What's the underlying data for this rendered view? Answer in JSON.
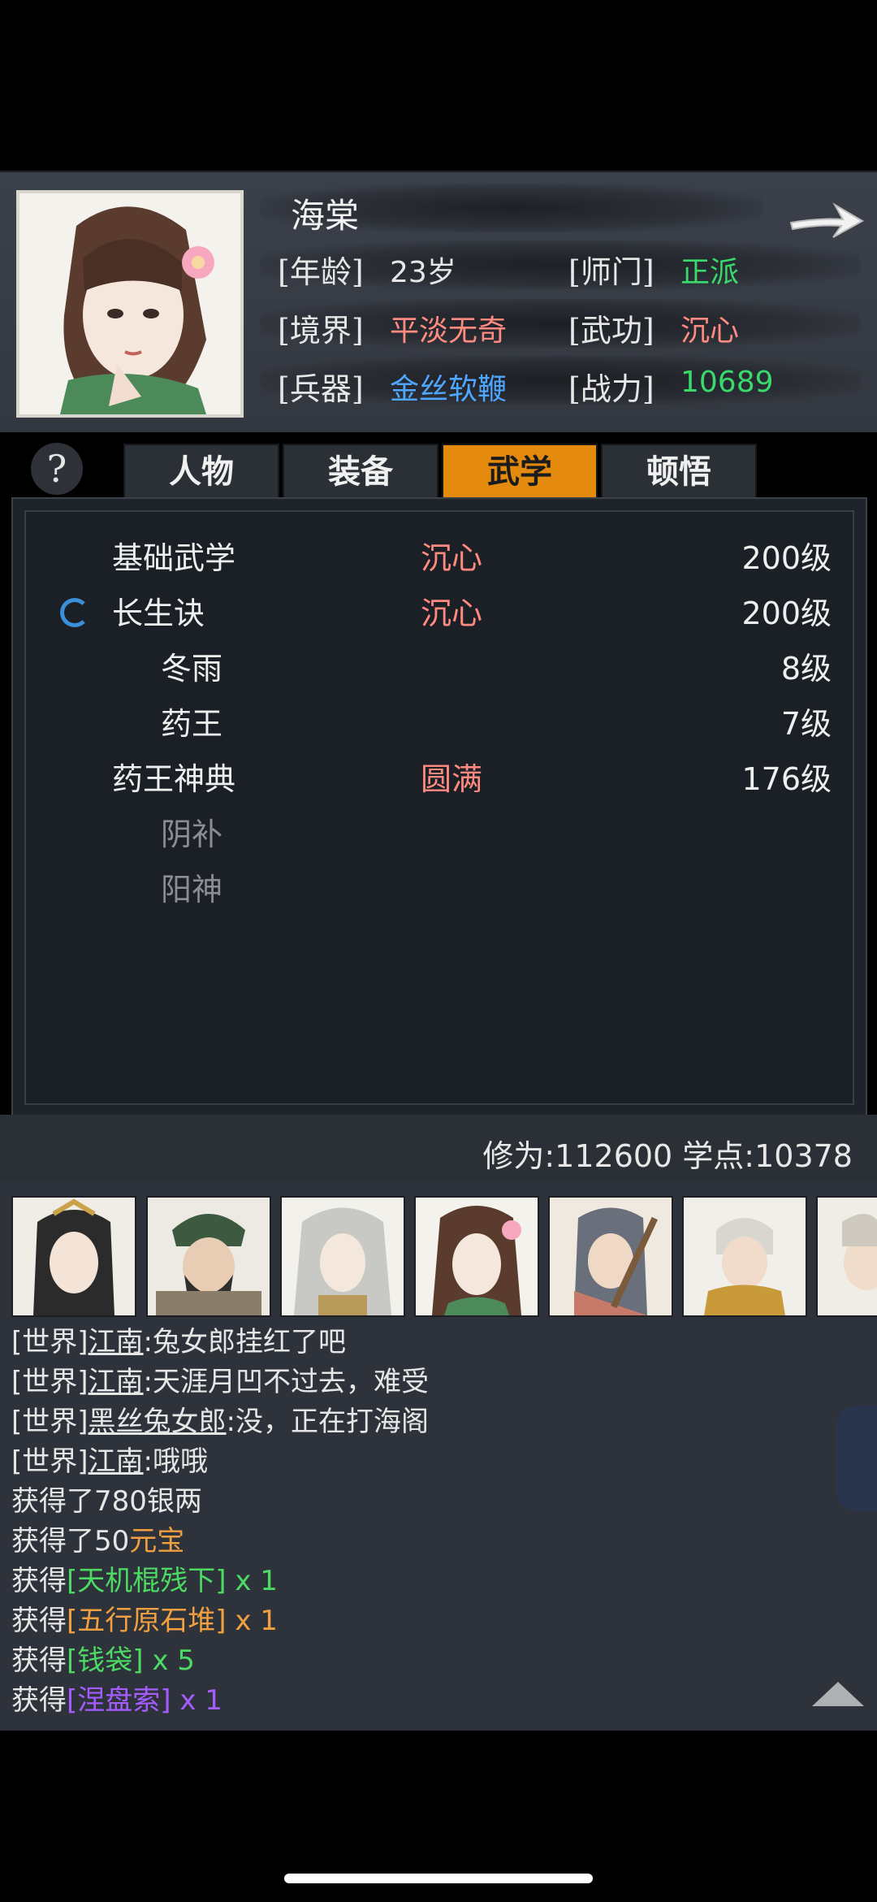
{
  "character": {
    "name": "海棠",
    "attributes": [
      {
        "label": "[年龄]",
        "value": "23岁",
        "color": "#e6e6e6"
      },
      {
        "label": "[师门]",
        "value": "正派",
        "color": "#39d96b"
      },
      {
        "label": "[境界]",
        "value": "平淡无奇",
        "color": "#ff8a80"
      },
      {
        "label": "[武功]",
        "value": "沉心",
        "color": "#ff8a80"
      },
      {
        "label": "[兵器]",
        "value": "金丝软鞭",
        "color": "#4fa6ff"
      },
      {
        "label": "[战力]",
        "value": "10689",
        "color": "#39d96b"
      }
    ]
  },
  "help_label": "?",
  "tabs": [
    {
      "label": "人物",
      "active": false
    },
    {
      "label": "装备",
      "active": false
    },
    {
      "label": "武学",
      "active": true
    },
    {
      "label": "顿悟",
      "active": false
    }
  ],
  "skills": [
    {
      "name": "基础武学",
      "state": "沉心",
      "level": "200级",
      "indent": false,
      "dim": false,
      "active": false
    },
    {
      "name": "长生诀",
      "state": "沉心",
      "level": "200级",
      "indent": false,
      "dim": false,
      "active": true
    },
    {
      "name": "冬雨",
      "state": "",
      "level": "8级",
      "indent": true,
      "dim": false,
      "active": false
    },
    {
      "name": "药王",
      "state": "",
      "level": "7级",
      "indent": true,
      "dim": false,
      "active": false
    },
    {
      "name": "药王神典",
      "state": "圆满",
      "level": "176级",
      "indent": false,
      "dim": false,
      "active": false
    },
    {
      "name": "阴补",
      "state": "",
      "level": "",
      "indent": true,
      "dim": true,
      "active": false
    },
    {
      "name": "阳神",
      "state": "",
      "level": "",
      "indent": true,
      "dim": true,
      "active": false
    }
  ],
  "points": {
    "text": "修为:112600  学点:10378"
  },
  "chat": [
    {
      "parts": [
        {
          "t": "[世界]",
          "c": "#e6e6e6"
        },
        {
          "t": "江南",
          "c": "#e6e6e6",
          "u": true
        },
        {
          "t": ":兔女郎挂红了吧",
          "c": "#e6e6e6"
        }
      ]
    },
    {
      "parts": [
        {
          "t": "[世界]",
          "c": "#e6e6e6"
        },
        {
          "t": "江南",
          "c": "#e6e6e6",
          "u": true
        },
        {
          "t": ":天涯月凹不过去，难受",
          "c": "#e6e6e6"
        }
      ]
    },
    {
      "parts": [
        {
          "t": "[世界]",
          "c": "#e6e6e6"
        },
        {
          "t": "黑丝兔女郎",
          "c": "#e6e6e6",
          "u": true
        },
        {
          "t": ":没，正在打海阁",
          "c": "#e6e6e6"
        }
      ]
    },
    {
      "parts": [
        {
          "t": "[世界]",
          "c": "#e6e6e6"
        },
        {
          "t": "江南",
          "c": "#e6e6e6",
          "u": true
        },
        {
          "t": ":哦哦",
          "c": "#e6e6e6"
        }
      ]
    },
    {
      "parts": [
        {
          "t": "获得了780银两",
          "c": "#e6e6e6"
        }
      ]
    },
    {
      "parts": [
        {
          "t": "获得了50",
          "c": "#e6e6e6"
        },
        {
          "t": "元宝",
          "c": "#f0a040"
        }
      ]
    },
    {
      "parts": [
        {
          "t": "获得",
          "c": "#e6e6e6"
        },
        {
          "t": "[天机棍残下]",
          "c": "#4cd964"
        },
        {
          "t": " x 1",
          "c": "#4cd964"
        }
      ]
    },
    {
      "parts": [
        {
          "t": "获得",
          "c": "#e6e6e6"
        },
        {
          "t": "[五行原石堆]",
          "c": "#f0a040"
        },
        {
          "t": " x 1",
          "c": "#f0a040"
        }
      ]
    },
    {
      "parts": [
        {
          "t": "获得",
          "c": "#e6e6e6"
        },
        {
          "t": "[钱袋]",
          "c": "#4cd964"
        },
        {
          "t": " x 5",
          "c": "#4cd964"
        }
      ]
    },
    {
      "parts": [
        {
          "t": "获得",
          "c": "#e6e6e6"
        },
        {
          "t": "[涅盘索]",
          "c": "#a45cff"
        },
        {
          "t": " x 1",
          "c": "#a45cff"
        }
      ]
    }
  ],
  "party_icons": [
    "female-hero-portrait",
    "bearded-general-portrait",
    "silver-hair-portrait",
    "haitang-portrait",
    "warrior-woman-portrait",
    "monk-portrait",
    "partial-portrait"
  ]
}
